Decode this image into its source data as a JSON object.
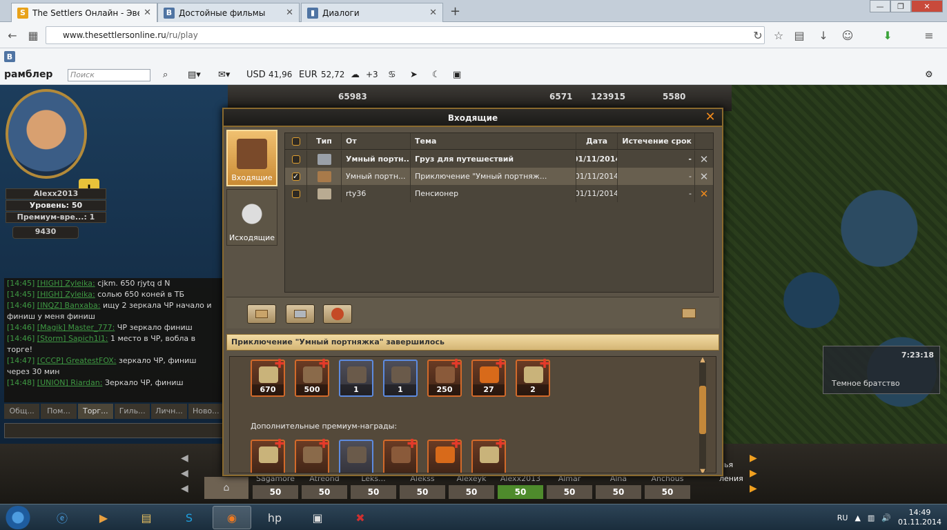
{
  "browser": {
    "tabs": [
      {
        "title": "The Settlers Онлайн - Эве...",
        "favicon": "S",
        "favicon_color": "#e8a21a",
        "active": true
      },
      {
        "title": "Достойные фильмы",
        "favicon": "В",
        "favicon_color": "#4f74a3",
        "active": false
      },
      {
        "title": "Диалоги",
        "favicon": "▮",
        "favicon_color": "#4f74a3",
        "active": false
      }
    ],
    "url_host": "www.thesettlersonline.ru",
    "url_path": "/ru/play",
    "bookmark_vk": "В"
  },
  "rambler": {
    "logo": "рамблер",
    "search_placeholder": "Поиск",
    "usd_label": "USD",
    "usd_value": "41,96",
    "eur_label": "EUR",
    "eur_value": "52,72",
    "weather": "+3"
  },
  "game": {
    "resources": {
      "res1": "65983",
      "res2": "123915",
      "res3": "5580",
      "res0": "6571"
    },
    "player": {
      "name": "Alexx2013",
      "level": "Уровень: 50",
      "premium": "Премиум-вре...: 1",
      "coins": "9430"
    },
    "chat": [
      {
        "time": "[14:45]",
        "name": "[HIGH] Zyleika:",
        "text": " cjkm. 650 rjytq d N"
      },
      {
        "time": "[14:45]",
        "name": "[HIGH] Zyleika:",
        "text": " солью 650 коней в ТБ"
      },
      {
        "time": "[14:46]",
        "name": "[INQZ] Banxaba:",
        "text": " ищу 2 зеркала ЧР начало и финиш у меня финиш"
      },
      {
        "time": "[14:46]",
        "name": "[Magik] Master_777:",
        "text": " ЧР зеркало финиш"
      },
      {
        "time": "[14:46]",
        "name": "[Storm] Sapich1l1:",
        "text": " 1 место в ЧР, вобла в торге!"
      },
      {
        "time": "[14:47]",
        "name": "[CCCP] GreatestFOX:",
        "text": " зеркало ЧР, финиш через 30 мин"
      },
      {
        "time": "[14:48]",
        "name": "[UNION] Riardan:",
        "text": " Зеркало ЧР, финиш"
      }
    ],
    "chat_tabs": [
      "Общ...",
      "Пом...",
      "Торг...",
      "Гиль...",
      "Личн...",
      "Ново..."
    ],
    "adventure": {
      "timer": "7:23:18",
      "name": "Темное братство"
    },
    "slots": [
      {
        "name": "Sagamore",
        "value": "50",
        "green": false
      },
      {
        "name": "Atreond",
        "value": "50",
        "green": false
      },
      {
        "name": "Leks...",
        "value": "50",
        "green": false
      },
      {
        "name": "Alekss",
        "value": "50",
        "green": false
      },
      {
        "name": "Alexeyk",
        "value": "50",
        "green": false
      },
      {
        "name": "Alexx2013",
        "value": "50",
        "green": true
      },
      {
        "name": "Almar",
        "value": "50",
        "green": false
      },
      {
        "name": "Alna",
        "value": "50",
        "green": false
      },
      {
        "name": "Anchous",
        "value": "50",
        "green": false
      }
    ],
    "right_labels": {
      "a": "лья",
      "b": "ления"
    }
  },
  "mail": {
    "title": "Входящие",
    "side_tabs": {
      "inbox": "Входящие",
      "outbox": "Исходящие"
    },
    "columns": {
      "type": "Тип",
      "from": "От",
      "subject": "Тема",
      "date": "Дата",
      "expire": "Истечение срок"
    },
    "rows": [
      {
        "from": "Умный портн...",
        "subject": "Груз для путешествий",
        "date": "01/11/2014",
        "expire": "-",
        "checked": false,
        "bold": true
      },
      {
        "from": "Умный портн...",
        "subject": "Приключение \"Умный портняж...",
        "date": "01/11/2014",
        "expire": "-",
        "checked": true,
        "bold": false
      },
      {
        "from": "rty36",
        "subject": "Пенсионер",
        "date": "01/11/2014",
        "expire": "-",
        "checked": false,
        "bold": false
      }
    ],
    "message_title": "Приключение \"Умный портняжка\" завершилось",
    "premium_label": "Дополнительные премиум-награды:",
    "rewards": [
      {
        "qty": "670",
        "type": "orange",
        "art": "#c9b37a"
      },
      {
        "qty": "500",
        "type": "orange",
        "art": "#8a6a4a"
      },
      {
        "qty": "1",
        "type": "blue",
        "art": "#6a5a4a"
      },
      {
        "qty": "1",
        "type": "blue",
        "art": "#6a5a4a"
      },
      {
        "qty": "250",
        "type": "orange",
        "art": "#8a5a3a"
      },
      {
        "qty": "27",
        "type": "orange",
        "art": "#d86a1a"
      },
      {
        "qty": "2",
        "type": "orange",
        "art": "#c9b37a"
      }
    ],
    "premium_rewards": [
      {
        "type": "orange",
        "art": "#c9b37a"
      },
      {
        "type": "orange",
        "art": "#8a6a4a"
      },
      {
        "type": "blue",
        "art": "#6a5a4a"
      },
      {
        "type": "orange",
        "art": "#8a5a3a"
      },
      {
        "type": "orange",
        "art": "#d86a1a"
      },
      {
        "type": "orange",
        "art": "#c9b37a"
      }
    ]
  },
  "taskbar": {
    "lang": "RU",
    "time": "14:49",
    "date": "01.11.2014"
  }
}
